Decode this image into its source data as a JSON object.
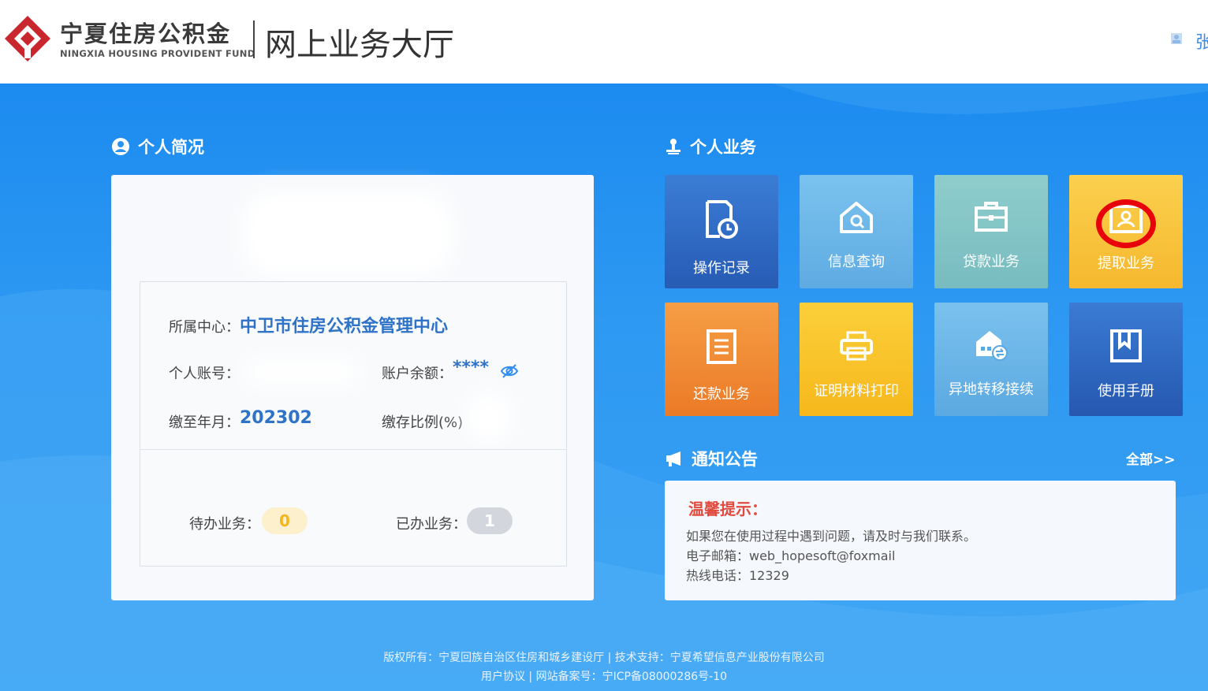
{
  "header": {
    "logo_cn": "宁夏住房公积金",
    "logo_en": "NINGXIA HOUSING PROVIDENT FUND",
    "site_title": "网上业务大厅",
    "user_name": "张"
  },
  "profile": {
    "section_title": "个人简况",
    "center_label": "所属中心：",
    "center_value": "中卫市住房公积金管理中心",
    "account_label": "个人账号：",
    "balance_label": "账户余额：",
    "balance_value": "****",
    "paid_until_label": "缴至年月：",
    "paid_until_value": "202302",
    "ratio_label": "缴存比例(%)",
    "pending_label": "待办业务：",
    "pending_count": "0",
    "done_label": "已办业务：",
    "done_count": "1"
  },
  "business": {
    "section_title": "个人业务",
    "tiles": [
      {
        "label": "操作记录",
        "icon": "document-clock-icon",
        "color": "#2f6bc6"
      },
      {
        "label": "信息查询",
        "icon": "house-search-icon",
        "color": "#6cb8e9"
      },
      {
        "label": "贷款业务",
        "icon": "briefcase-icon",
        "color": "#86c7c8"
      },
      {
        "label": "提取业务",
        "icon": "id-card-icon",
        "color": "#f7c23c"
      },
      {
        "label": "还款业务",
        "icon": "ledger-icon",
        "color": "#f08a32"
      },
      {
        "label": "证明材料打印",
        "icon": "printer-icon",
        "color": "#f8c42a"
      },
      {
        "label": "异地转移接续",
        "icon": "house-transfer-icon",
        "color": "#6bb6e8"
      },
      {
        "label": "使用手册",
        "icon": "bookmark-book-icon",
        "color": "#2f6bc6"
      }
    ]
  },
  "notice": {
    "section_title": "通知公告",
    "more_link": "全部>>",
    "heading": "温馨提示：",
    "line1": "如果您在使用过程中遇到问题，请及时与我们联系。",
    "line2": "电子邮箱：web_hopesoft@foxmail",
    "line3": "热线电话：12329"
  },
  "footer": {
    "line1": "版权所有：宁夏回族自治区住房和城乡建设厅 | 技术支持：宁夏希望信息产业股份有限公司",
    "line2": "用户协议 | 网站备案号：宁ICP备08000286号-10"
  },
  "colors": {
    "brand_red": "#c8282d",
    "accent_blue": "#2f73c8",
    "highlight_ring": "#e8000b"
  }
}
